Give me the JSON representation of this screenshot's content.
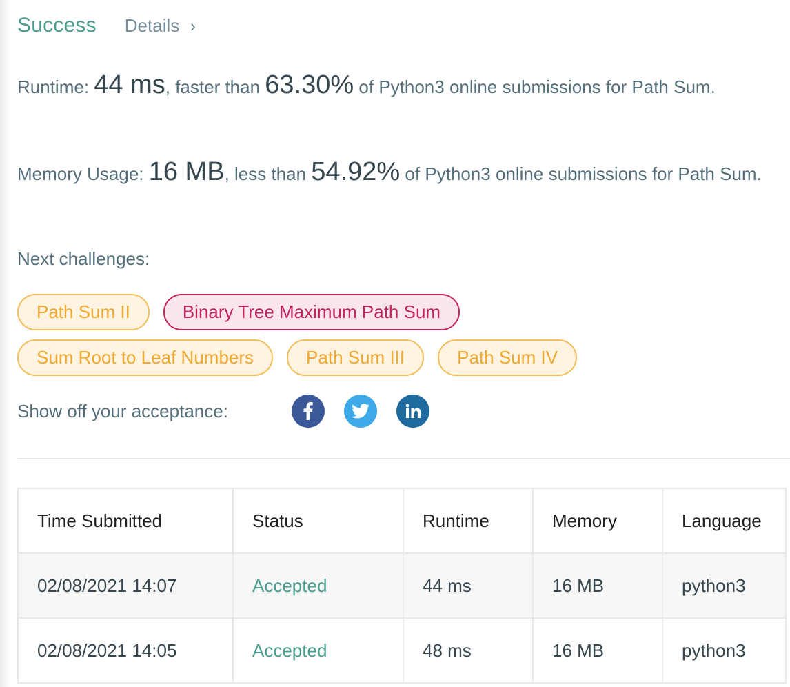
{
  "header": {
    "status_label": "Success",
    "details_label": "Details"
  },
  "runtime": {
    "label": "Runtime:",
    "value": "44 ms",
    "comparison": ", faster than ",
    "percent": "63.30%",
    "suffix": " of Python3 online submissions for Path Sum."
  },
  "memory": {
    "label": "Memory Usage:",
    "value": "16 MB",
    "comparison": ", less than ",
    "percent": "54.92%",
    "suffix": " of Python3 online submissions for Path Sum."
  },
  "next_challenges": {
    "label": "Next challenges:",
    "items": [
      {
        "label": "Path Sum II",
        "difficulty": "medium"
      },
      {
        "label": "Binary Tree Maximum Path Sum",
        "difficulty": "hard"
      },
      {
        "label": "Sum Root to Leaf Numbers",
        "difficulty": "medium"
      },
      {
        "label": "Path Sum III",
        "difficulty": "medium"
      },
      {
        "label": "Path Sum IV",
        "difficulty": "medium"
      }
    ]
  },
  "share": {
    "label": "Show off your acceptance:",
    "icons": [
      "facebook-icon",
      "twitter-icon",
      "linkedin-icon"
    ]
  },
  "submissions": {
    "columns": [
      "Time Submitted",
      "Status",
      "Runtime",
      "Memory",
      "Language"
    ],
    "rows": [
      {
        "time": "02/08/2021 14:07",
        "status": "Accepted",
        "runtime": "44 ms",
        "memory": "16 MB",
        "language": "python3"
      },
      {
        "time": "02/08/2021 14:05",
        "status": "Accepted",
        "runtime": "48 ms",
        "memory": "16 MB",
        "language": "python3"
      }
    ]
  },
  "colors": {
    "accent_green": "#4a9e8f",
    "medium_chip": "#f0a830",
    "hard_chip": "#c2245f",
    "facebook": "#3b5998",
    "twitter": "#3da9e8",
    "linkedin": "#1f6a9e"
  }
}
